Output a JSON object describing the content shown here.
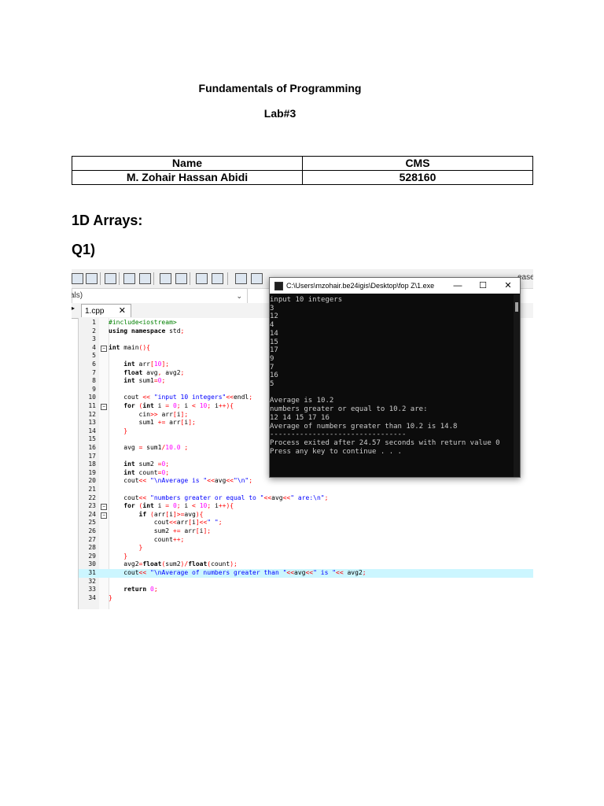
{
  "document": {
    "title": "Fundamentals of Programming",
    "subtitle": "Lab#3",
    "table": {
      "headers": [
        "Name",
        "CMS"
      ],
      "rows": [
        [
          "M. Zohair Hassan Abidi",
          "528160"
        ]
      ]
    },
    "section_heading": "1D Arrays:",
    "question_heading": "Q1)"
  },
  "ide": {
    "combo_text": "als)",
    "tab_label": "1.cpp",
    "tab_close": "✕",
    "toolbar_tail_text": "ease",
    "code_lines": [
      {
        "n": "1",
        "t": "#include<iostream>"
      },
      {
        "n": "2",
        "t": "using namespace std;"
      },
      {
        "n": "3",
        "t": ""
      },
      {
        "n": "4",
        "t": "int main(){"
      },
      {
        "n": "5",
        "t": ""
      },
      {
        "n": "6",
        "t": "    int arr[10];"
      },
      {
        "n": "7",
        "t": "    float avg, avg2;"
      },
      {
        "n": "8",
        "t": "    int sum1=0;"
      },
      {
        "n": "9",
        "t": ""
      },
      {
        "n": "10",
        "t": "    cout << \"input 10 integers\"<<endl;"
      },
      {
        "n": "11",
        "t": "    for (int i = 0; i < 10; i++){"
      },
      {
        "n": "12",
        "t": "        cin>> arr[i];"
      },
      {
        "n": "13",
        "t": "        sum1 += arr[i];"
      },
      {
        "n": "14",
        "t": "    }"
      },
      {
        "n": "15",
        "t": ""
      },
      {
        "n": "16",
        "t": "    avg = sum1/10.0 ;"
      },
      {
        "n": "17",
        "t": ""
      },
      {
        "n": "18",
        "t": "    int sum2 =0;"
      },
      {
        "n": "19",
        "t": "    int count=0;"
      },
      {
        "n": "20",
        "t": "    cout<< \"\\nAverage is \"<<avg<<\"\\n\";"
      },
      {
        "n": "21",
        "t": ""
      },
      {
        "n": "22",
        "t": "    cout<< \"numbers greater or equal to \"<<avg<<\" are:\\n\";"
      },
      {
        "n": "23",
        "t": "    for (int i = 0; i < 10; i++){"
      },
      {
        "n": "24",
        "t": "        if (arr[i]>=avg){"
      },
      {
        "n": "25",
        "t": "            cout<<arr[i]<<\" \";"
      },
      {
        "n": "26",
        "t": "            sum2 += arr[i];"
      },
      {
        "n": "27",
        "t": "            count++;"
      },
      {
        "n": "28",
        "t": "        }"
      },
      {
        "n": "29",
        "t": "    }"
      },
      {
        "n": "30",
        "t": "    avg2=float(sum2)/float(count);"
      },
      {
        "n": "31",
        "t": "    cout<< \"\\nAverage of numbers greater than \"<<avg<<\" is \"<< avg2;"
      },
      {
        "n": "32",
        "t": ""
      },
      {
        "n": "33",
        "t": "    return 0;"
      },
      {
        "n": "34",
        "t": "}"
      }
    ],
    "highlight_line": "31"
  },
  "console": {
    "title": "C:\\Users\\mzohair.be24igis\\Desktop\\fop Z\\1.exe",
    "minimize": "—",
    "maximize": "☐",
    "close": "✕",
    "lines": [
      "input 10 integers",
      "3",
      "12",
      "4",
      "14",
      "15",
      "17",
      "9",
      "7",
      "16",
      "5",
      "",
      "Average is 10.2",
      "numbers greater or equal to 10.2 are:",
      "12 14 15 17 16",
      "Average of numbers greater than 10.2 is 14.8",
      "--------------------------------",
      "Process exited after 24.57 seconds with return value 0",
      "Press any key to continue . . ."
    ]
  }
}
